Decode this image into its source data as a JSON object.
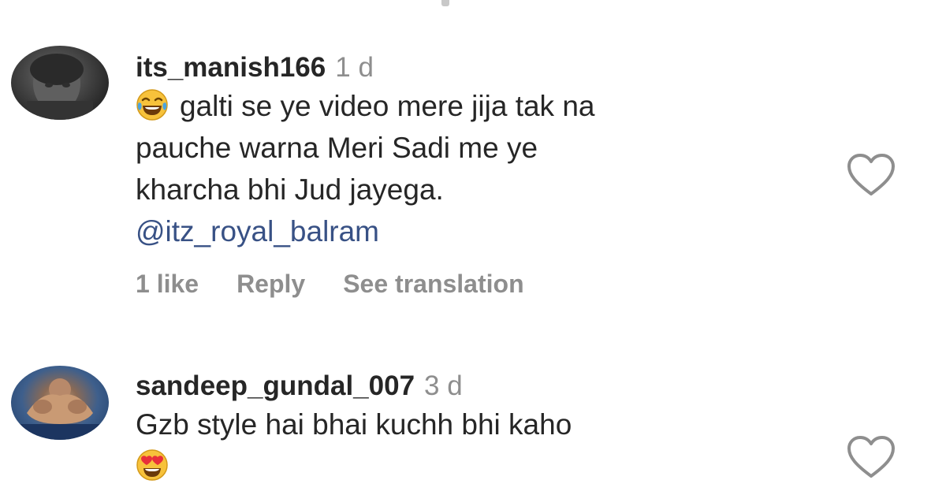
{
  "comments": [
    {
      "username": "its_manish166",
      "time": "1 d",
      "emoji": "laughing-tears-emoji",
      "lines": [
        "galti se ye video mere jija tak na",
        "pauche warna Meri Sadi me ye",
        "kharcha bhi Jud jayega."
      ],
      "mention": "@itz_royal_balram",
      "likes": "1 like",
      "reply": "Reply",
      "translate": "See translation"
    },
    {
      "username": "sandeep_gundal_007",
      "time": "3 d",
      "lines": [
        "Gzb style hai bhai kuchh bhi kaho"
      ],
      "emoji": "heart-eyes-emoji"
    }
  ],
  "colors": {
    "username": "#262626",
    "secondary": "#8e8e8e",
    "mention": "#385185",
    "heart_outline": "#8e8e8e"
  },
  "icons": {
    "like": "heart-outline-icon"
  }
}
